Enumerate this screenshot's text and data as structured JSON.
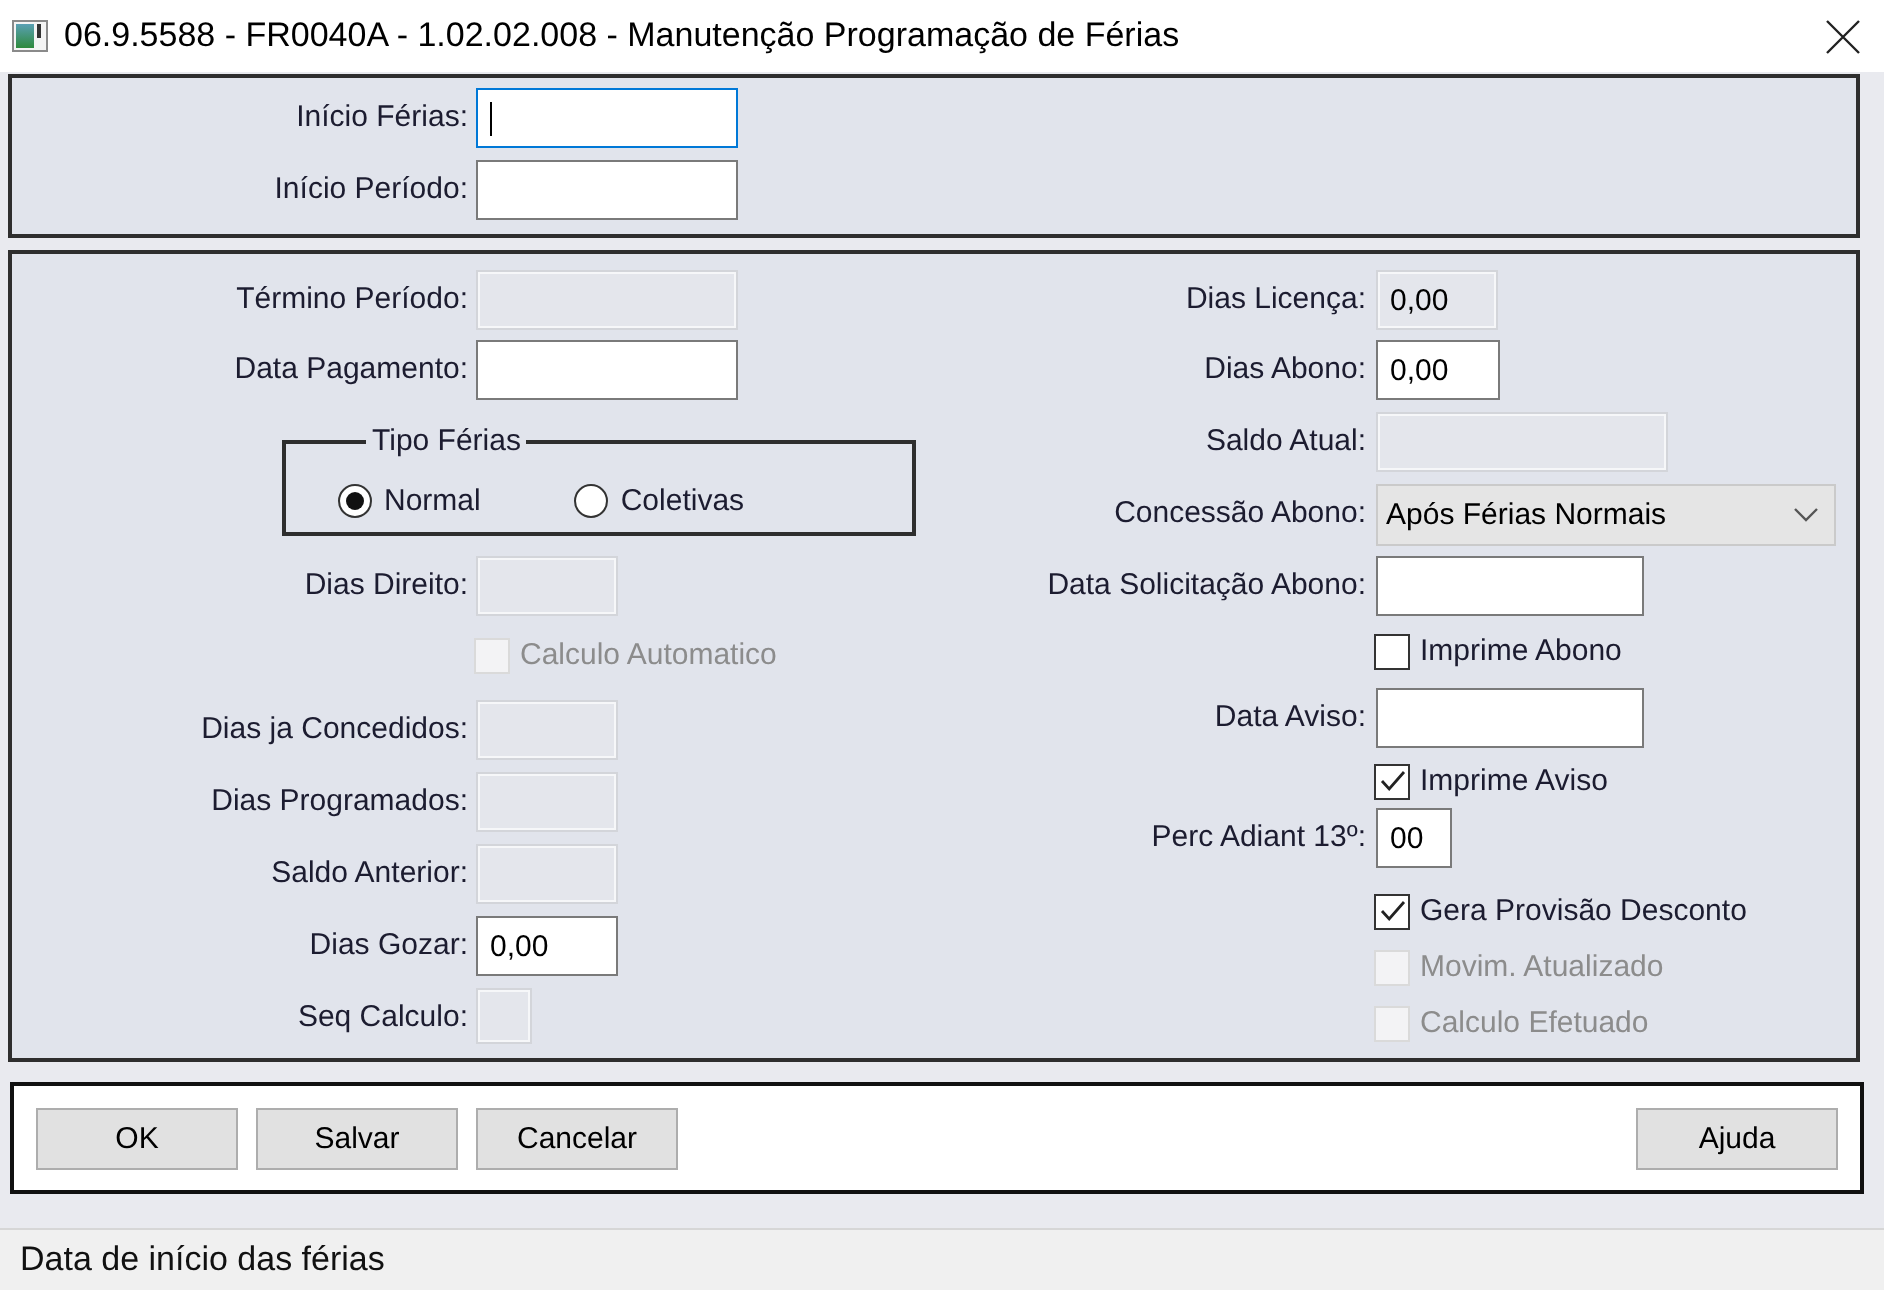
{
  "window": {
    "title": "06.9.5588 - FR0040A - 1.02.02.008 - Manutenção Programação de Férias"
  },
  "header_panel": {
    "fields": [
      {
        "label": "Início Férias:",
        "focused": true,
        "disabled": false
      },
      {
        "label": "Início Período:",
        "focused": false,
        "disabled": false
      }
    ]
  },
  "main_panel": {
    "left_column": [
      {
        "kind": "field",
        "label": "Término Período:",
        "disabled": true
      },
      {
        "kind": "field",
        "label": "Data Pagamento:",
        "disabled": false
      },
      {
        "kind": "radio_group",
        "legend": "Tipo Férias",
        "options": [
          {
            "label": "Normal",
            "selected": true
          },
          {
            "label": "Coletivas",
            "selected": false
          }
        ]
      },
      {
        "kind": "field",
        "label": "Dias Direito:",
        "disabled": true
      },
      {
        "kind": "checkbox",
        "label": "Calculo Automatico",
        "checked": false,
        "disabled": true
      },
      {
        "kind": "field",
        "label": "Dias ja Concedidos:",
        "disabled": true
      },
      {
        "kind": "field",
        "label": "Dias Programados:",
        "disabled": true
      },
      {
        "kind": "field",
        "label": "Saldo Anterior:",
        "disabled": true
      },
      {
        "kind": "field",
        "label": "Dias Gozar:",
        "value": "0,00",
        "disabled": false
      },
      {
        "kind": "field",
        "label": "Seq Calculo:",
        "disabled": true
      }
    ],
    "right_column": [
      {
        "kind": "field",
        "label": "Dias Licença:",
        "value": "0,00",
        "disabled": true
      },
      {
        "kind": "field",
        "label": "Dias Abono:",
        "value": "0,00",
        "disabled": false
      },
      {
        "kind": "field",
        "label": "Saldo Atual:",
        "disabled": true
      },
      {
        "kind": "select",
        "label": "Concessão Abono:",
        "value": "Após Férias Normais",
        "disabled": false
      },
      {
        "kind": "field",
        "label": "Data Solicitação Abono:",
        "disabled": false
      },
      {
        "kind": "checkbox",
        "label": "Imprime Abono",
        "checked": false,
        "disabled": false
      },
      {
        "kind": "field",
        "label": "Data Aviso:",
        "disabled": false
      },
      {
        "kind": "checkbox",
        "label": "Imprime Aviso",
        "checked": true,
        "disabled": false
      },
      {
        "kind": "field",
        "label": "Perc Adiant 13º:",
        "value": "00",
        "disabled": false
      },
      {
        "kind": "checkbox",
        "label": "Gera Provisão Desconto",
        "checked": true,
        "disabled": false
      },
      {
        "kind": "checkbox",
        "label": "Movim. Atualizado",
        "checked": false,
        "disabled": true
      },
      {
        "kind": "checkbox",
        "label": "Calculo Efetuado",
        "checked": false,
        "disabled": true
      }
    ]
  },
  "buttons": [
    "OK",
    "Salvar",
    "Cancelar"
  ],
  "help_button": "Ajuda",
  "status_bar": {
    "text": "Data de início das férias"
  }
}
